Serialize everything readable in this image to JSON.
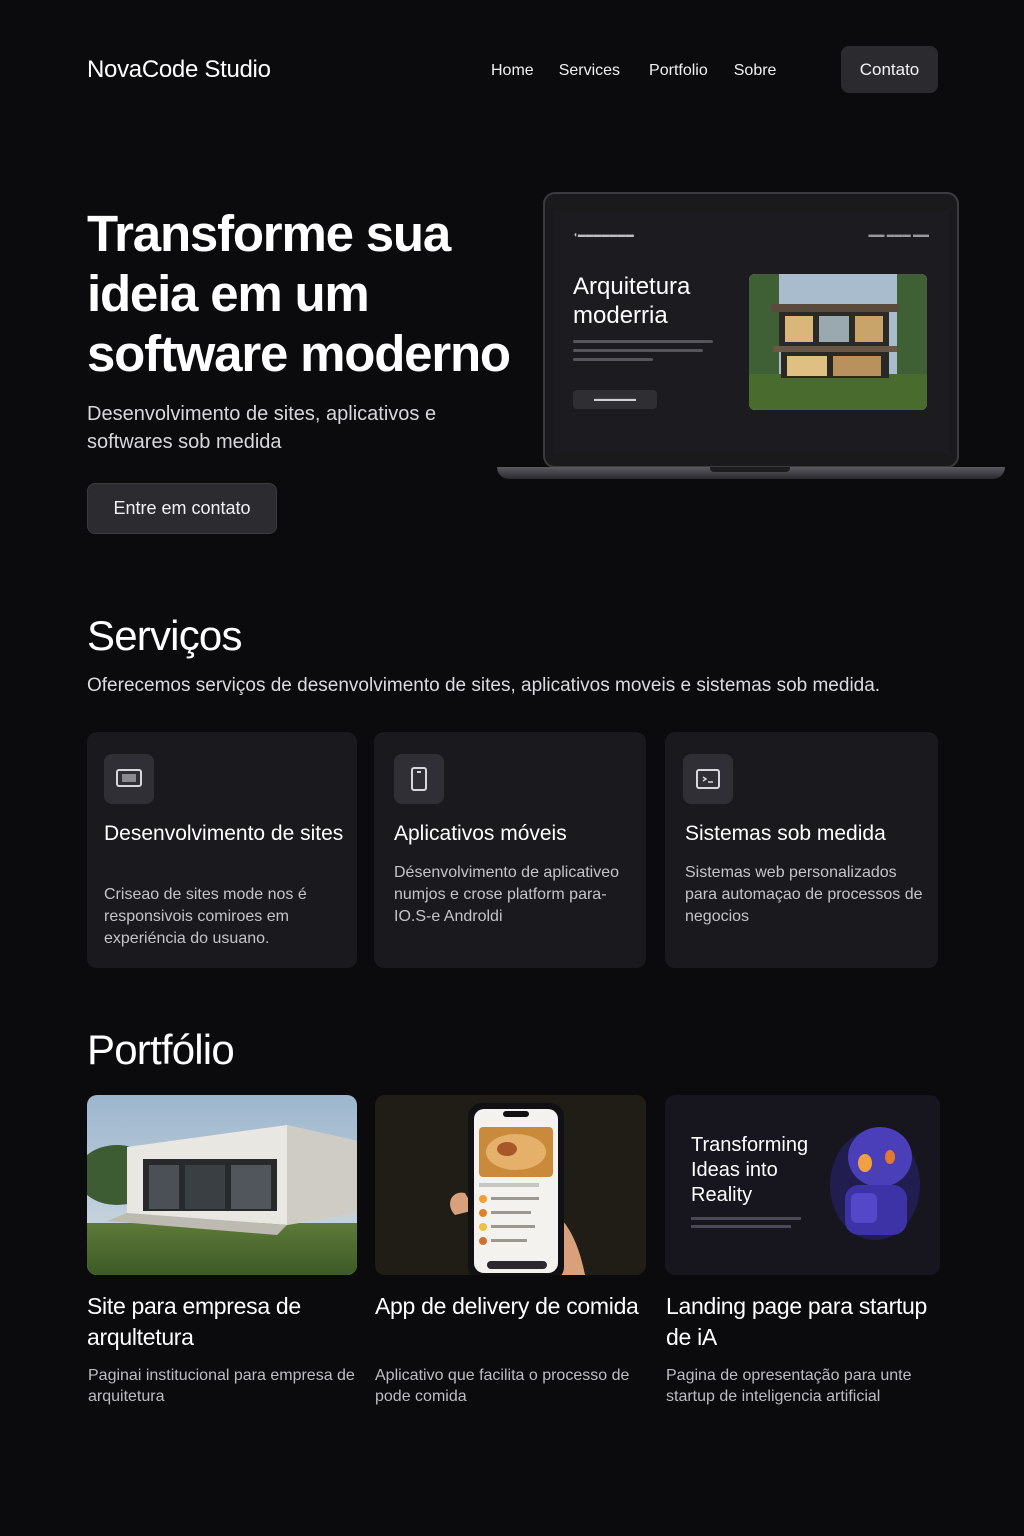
{
  "header": {
    "brand": "NovaCode Studio",
    "nav": [
      "Home",
      "Services",
      "Portfolio",
      "Sobre"
    ],
    "contact_label": "Contato"
  },
  "hero": {
    "title": "Transforme sua ideia em um software moderno",
    "subtitle": "Desenvolvimento de sites, aplicativos e softwares sob medida",
    "cta_label": "Entre em contato",
    "laptop": {
      "title": "Arquitetura moderria"
    }
  },
  "services": {
    "title": "Serviços",
    "subtitle": "Oferecemos serviços de desenvolvimento de sites, aplicativos moveis e sistemas sob medida.",
    "cards": [
      {
        "icon": "monitor-icon",
        "title": "Desenvolvimento de sites",
        "desc": "Criseao de sites mode nos é responsivois comiroes em experiéncia do usuano."
      },
      {
        "icon": "smartphone-icon",
        "title": "Aplicativos móveis",
        "desc": "Désenvolvimento de aplicativeo numjos e crose platform para-IO.S-e Androldi"
      },
      {
        "icon": "code-window-icon",
        "title": "Sistemas sob medida",
        "desc": "Sistemas web personalizados para automaçao de processos de negocios"
      }
    ]
  },
  "portfolio": {
    "title": "Portfólio",
    "items": [
      {
        "title": "Site para empresa de arqultetura",
        "desc": "Paginai institucional para empresa de arquitetura"
      },
      {
        "title": "App de delivery de comida",
        "desc": "Aplicativo que facilita o processo de pode comida"
      },
      {
        "title": "Landing page para startup de iA",
        "desc": "Pagina de opresentação para unte startup de inteligencia artificial",
        "image_text": "Transforming Ideas into Reality"
      }
    ]
  },
  "colors": {
    "background": "#0b0b0e",
    "card": "#1a1a1e",
    "button": "#2a2a2f",
    "text": "#ffffff",
    "muted": "#c4c4c9"
  }
}
